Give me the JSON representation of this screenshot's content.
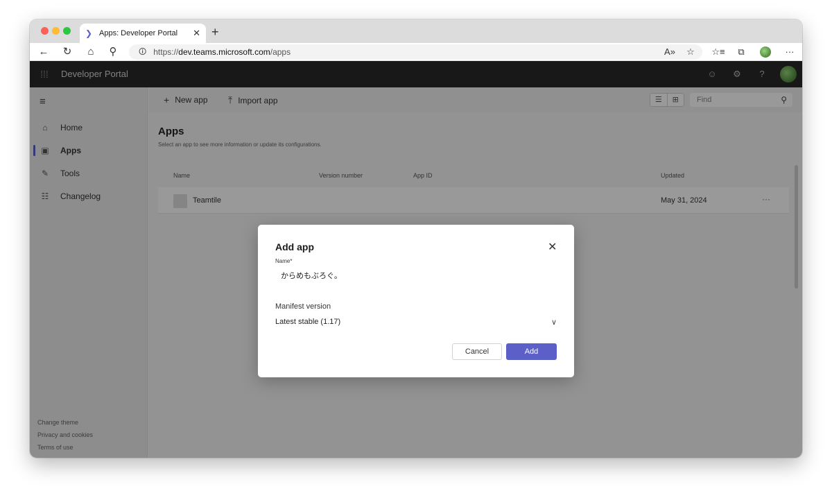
{
  "browser": {
    "tab_title": "Apps: Developer Portal",
    "url_prefix": "https://",
    "url_host": "dev.teams.microsoft.com",
    "url_path": "/apps"
  },
  "topbar": {
    "title": "Developer Portal"
  },
  "sidebar": {
    "items": [
      {
        "label": "Home",
        "icon": "home-icon"
      },
      {
        "label": "Apps",
        "icon": "apps-icon",
        "active": true
      },
      {
        "label": "Tools",
        "icon": "tools-icon"
      },
      {
        "label": "Changelog",
        "icon": "changelog-icon"
      }
    ],
    "footer": [
      "Change theme",
      "Privacy and cookies",
      "Terms of use"
    ]
  },
  "toolbar": {
    "new_app": "New app",
    "import_app": "Import app",
    "find_placeholder": "Find"
  },
  "page": {
    "title": "Apps",
    "subtitle": "Select an app to see more information or update its configurations."
  },
  "table": {
    "columns": [
      "Name",
      "Version number",
      "App ID",
      "Updated"
    ],
    "rows": [
      {
        "name": "Teamtile",
        "version": "",
        "app_id": "",
        "updated": "May 31, 2024"
      }
    ]
  },
  "dialog": {
    "title": "Add app",
    "name_label": "Name",
    "name_required_marker": "*",
    "name_value": "からめもぶろぐ。",
    "manifest_label": "Manifest version",
    "manifest_value": "Latest stable (1.17)",
    "cancel_label": "Cancel",
    "add_label": "Add"
  },
  "colors": {
    "accent": "#5b5fc7",
    "topbar": "#292929"
  }
}
